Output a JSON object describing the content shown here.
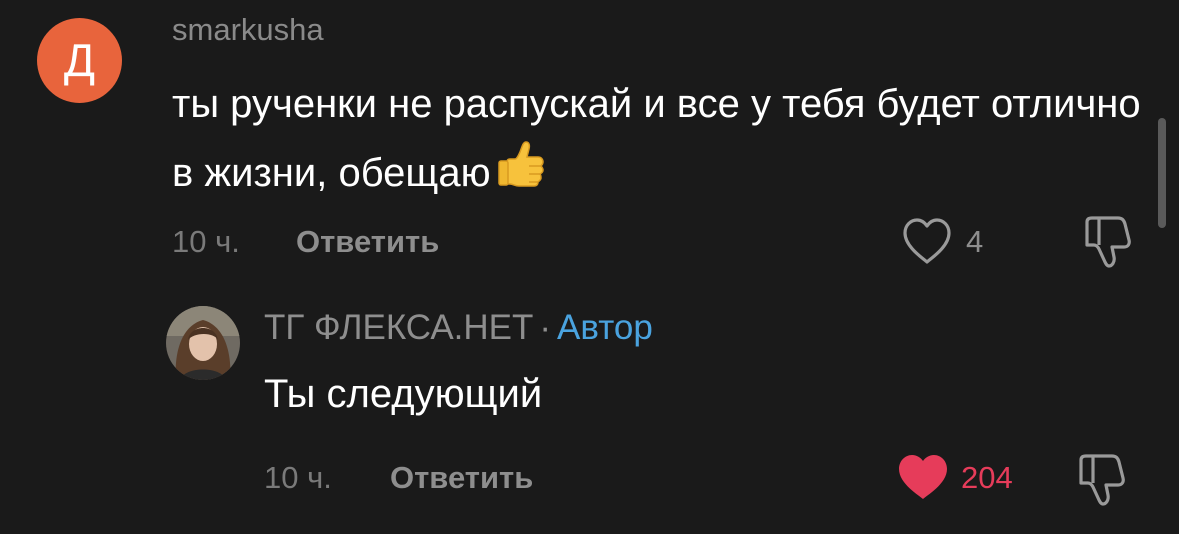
{
  "colors": {
    "background": "#1a1a1a",
    "avatar_orange": "#e8643c",
    "author_badge": "#4aa3df",
    "liked_heart": "#e63c5a"
  },
  "comment": {
    "avatar_letter": "Д",
    "username": "smarkusha",
    "text": "ты рученки не распускай и все у тебя будет отлично в жизни, обещаю",
    "emoji": "thumbs-up",
    "time": "10 ч.",
    "reply_label": "Ответить",
    "likes": "4",
    "liked": false
  },
  "reply": {
    "author": "ТГ ФЛЕКСА.НЕТ",
    "separator": "·",
    "badge": "Автор",
    "text": "Ты следующий",
    "time": "10 ч.",
    "reply_label": "Ответить",
    "likes": "204",
    "liked": true
  }
}
